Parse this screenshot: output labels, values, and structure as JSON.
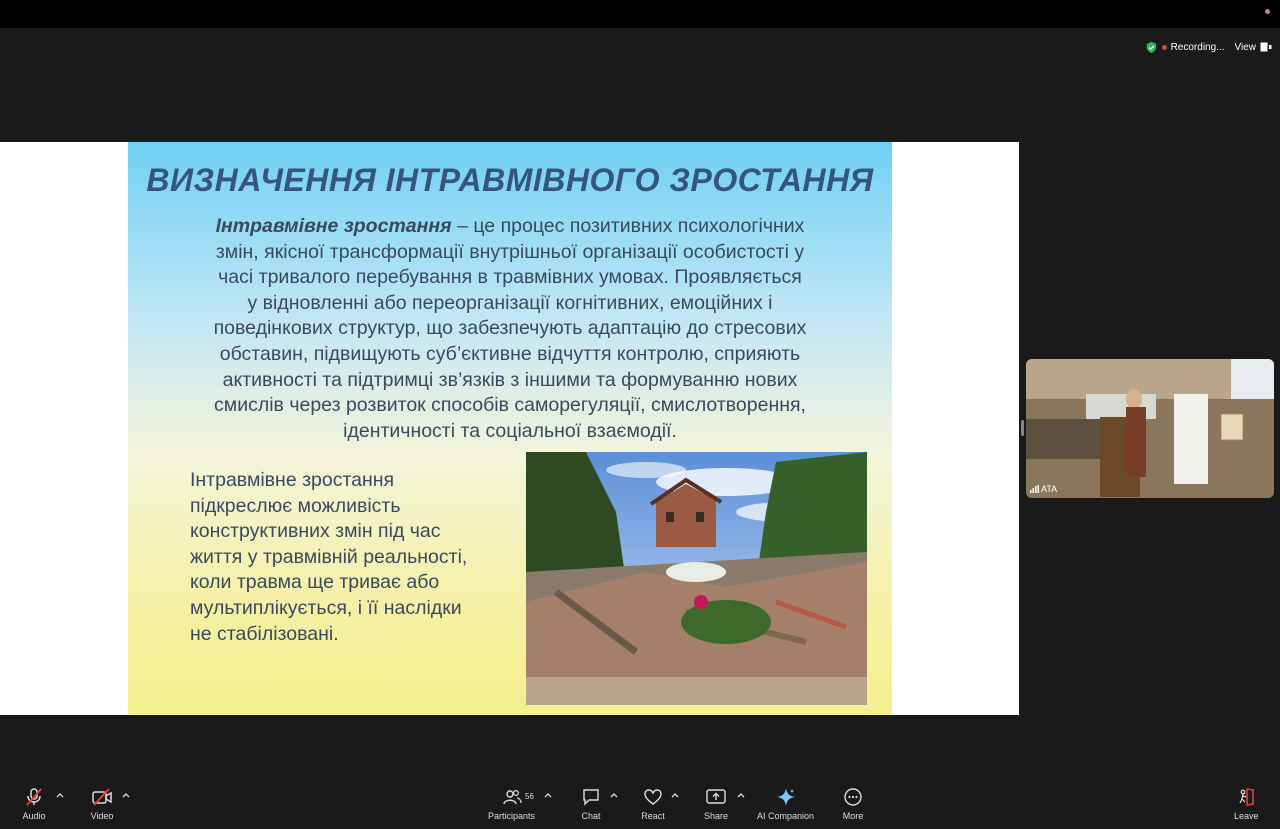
{
  "status": {
    "recording": "Recording...",
    "view": "View"
  },
  "slide": {
    "title": "ВИЗНАЧЕННЯ ІНТРАВМІВНОГО ЗРОСТАННЯ",
    "def_term": "Інтравмівне зростання",
    "def_lines": [
      " – це процес позитивних психологічних",
      "змін, якісної трансформації внутрішньої організації особистості у",
      "часі тривалого перебування в травмівних умовах. Проявляється",
      "у відновленні або переорганізації когнітивних, емоційних і",
      "поведінкових структур, що забезпечують адаптацію до стресових",
      "обставин, підвищують суб’єктивне відчуття контролю, сприяють",
      "активності та підтримці зв’язків з іншими та формуванню нових",
      "смислів через розвиток способів саморегуляції, смислотворення,",
      "ідентичності та соціальної взаємодії."
    ],
    "text2_lines": [
      "Інтравмівне зростання",
      "підкреслює можливість",
      "конструктивних змін під час",
      "життя у травмівній реальності,",
      "коли травма ще триває або",
      "мультиплікується, і її наслідки",
      "не стабілізовані."
    ]
  },
  "video": {
    "name": "ATA"
  },
  "toolbar": {
    "audio": "Audio",
    "video": "Video",
    "participants": "Participants",
    "participants_count": "56",
    "chat": "Chat",
    "react": "React",
    "share": "Share",
    "ai": "AI Companion",
    "more": "More",
    "leave": "Leave"
  },
  "colors": {
    "accent_red": "#e5423b",
    "recording_shield": "#2fb35a",
    "ai_star": "#7ec8ff"
  }
}
